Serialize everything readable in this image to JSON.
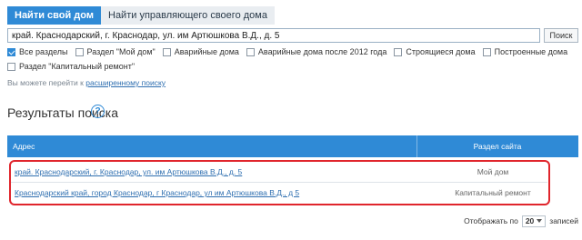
{
  "tabs": [
    {
      "label": "Найти свой дом",
      "active": true
    },
    {
      "label": "Найти управляющего своего дома",
      "active": false
    }
  ],
  "search": {
    "value": "край. Краснодарский, г. Краснодар, ул. им Артюшкова В.Д., д. 5",
    "button_label": "Поиск"
  },
  "filters": {
    "line1": [
      {
        "label": "Все разделы",
        "checked": true
      },
      {
        "label": "Раздел \"Мой дом\"",
        "checked": false
      },
      {
        "label": "Аварийные дома",
        "checked": false
      },
      {
        "label": "Аварийные дома после 2012 года",
        "checked": false
      },
      {
        "label": "Строящиеся дома",
        "checked": false
      },
      {
        "label": "Построенные дома",
        "checked": false
      }
    ],
    "line2": [
      {
        "label": "Раздел \"Капитальный ремонт\"",
        "checked": false
      }
    ]
  },
  "advanced": {
    "prefix": "Вы можете перейти к ",
    "link": "расширенному поиску"
  },
  "results": {
    "title": "Результаты поиска",
    "help_icon": "question-circle-icon",
    "columns": [
      "Адрес",
      "Раздел сайта"
    ],
    "rows": [
      {
        "address": "край. Краснодарский, г. Краснодар, ул. им Артюшкова В.Д., д. 5",
        "section": "Мой дом"
      },
      {
        "address": "Краснодарский край, город Краснодар, г Краснодар, ул им Артюшкова В.Д., д 5",
        "section": "Капитальный ремонт"
      }
    ]
  },
  "pager": {
    "prefix": "Отображать по",
    "value": "20",
    "suffix": "записей"
  },
  "colors": {
    "accent": "#2f8ad6",
    "highlight": "#e0252c"
  }
}
